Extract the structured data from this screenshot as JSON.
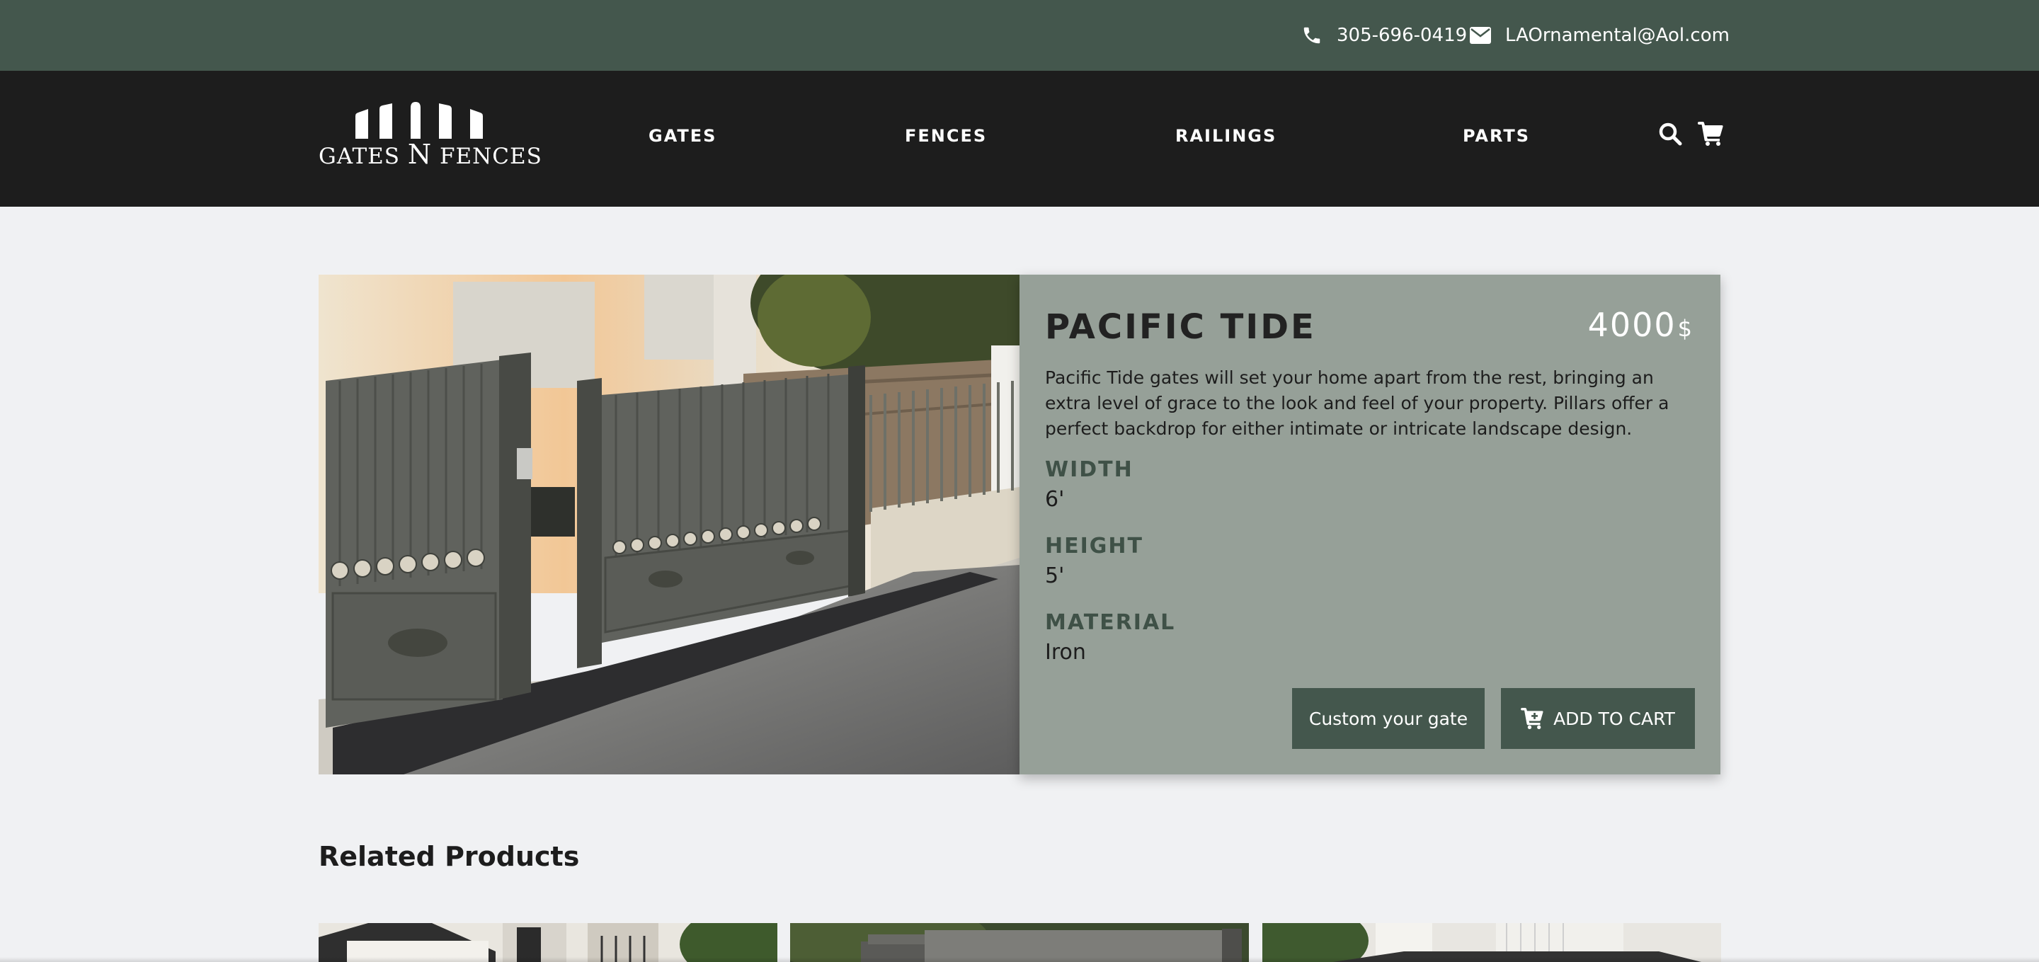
{
  "topbar": {
    "phone_icon": "phone-icon",
    "phone": "305-696-0419",
    "email_icon": "envelope-icon",
    "email": "LAOrnamental@Aol.com"
  },
  "nav": {
    "logo_text_left": "GATES",
    "logo_text_mid": "N",
    "logo_text_right": "FENCES",
    "items": [
      "GATES",
      "FENCES",
      "RAILINGS",
      "PARTS"
    ],
    "search_icon": "search-icon",
    "cart_icon": "cart-icon"
  },
  "product": {
    "title": "PACIFIC TIDE",
    "price": "4000",
    "currency": "$",
    "description": "Pacific Tide gates will set your home apart from the rest, bringing an extra level of grace to the look and feel of your property. Pillars offer a perfect backdrop for either intimate or intricate landscape design.",
    "specs": [
      {
        "label": "WIDTH",
        "value": "6'"
      },
      {
        "label": "HEIGHT",
        "value": "5'"
      },
      {
        "label": "MATERIAL",
        "value": "Iron"
      }
    ],
    "custom_button": "Custom your gate",
    "cart_button": "ADD TO CART"
  },
  "related": {
    "title": "Related Products"
  },
  "colors": {
    "topbar": "#44574d",
    "navbar": "#1d1d1d",
    "panel": "#96a098",
    "button": "#44574d",
    "page_bg": "#f0f1f3"
  }
}
